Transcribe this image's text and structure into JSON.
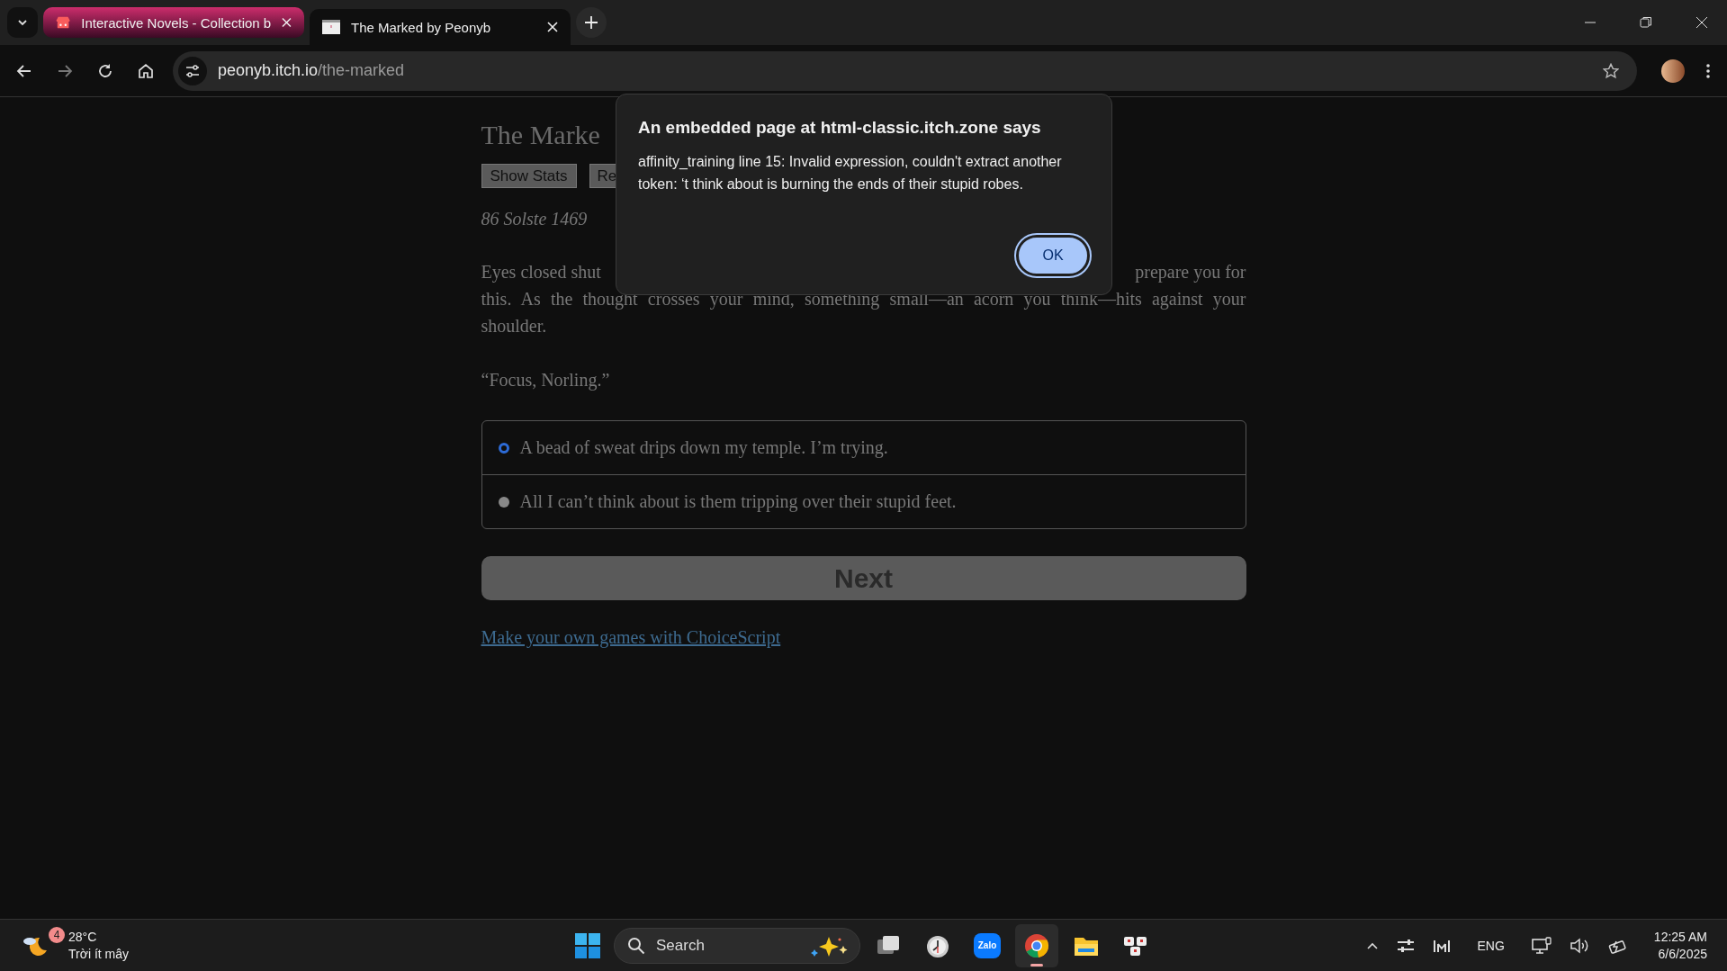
{
  "browser": {
    "tabs": [
      {
        "title": "Interactive Novels - Collection b",
        "selected": false,
        "kind": "group"
      },
      {
        "title": "The Marked by Peonyb",
        "selected": true,
        "kind": "page"
      }
    ],
    "url": {
      "host": "peonyb.itch.io",
      "path": "/the-marked"
    }
  },
  "game": {
    "title": "The Marke",
    "buttons": [
      "Show Stats",
      "Re"
    ],
    "date": "86 Solste 1469",
    "line_1_start": "Eyes closed shut",
    "line_1_end": "prepare you for",
    "line_2": "this. As the thought crosses your mind, something small—an acorn you think—hits against your",
    "line_3": "shoulder.",
    "quote": "“Focus, Norling.”",
    "choices": [
      {
        "text": "A bead of sweat drips down my temple. I’m trying.",
        "selected": true
      },
      {
        "text": "All I can’t think about is them tripping over their stupid feet.",
        "selected": false
      }
    ],
    "next_button": "Next",
    "link": "Make your own games with ChoiceScript"
  },
  "dialog": {
    "title": "An embedded page at html-classic.itch.zone says",
    "message": "affinity_training line 15: Invalid expression, couldn't extract another token: ‘t think about is burning the ends of their stupid robes.",
    "button": "OK"
  },
  "taskbar": {
    "weather": {
      "badge": "4",
      "temperature": "28°C",
      "condition": "Trời ít mây"
    },
    "search": {
      "placeholder": "Search"
    },
    "apps": [
      {
        "kind": "taskview",
        "selected": false
      },
      {
        "kind": "clock",
        "selected": false
      },
      {
        "kind": "zalo",
        "label": "Zalo",
        "selected": false
      },
      {
        "kind": "chrome",
        "selected": true
      },
      {
        "kind": "explorer",
        "selected": false
      },
      {
        "kind": "keys",
        "selected": false
      }
    ],
    "language": "ENG",
    "time": "12:25 AM",
    "date": "6/6/2025"
  }
}
